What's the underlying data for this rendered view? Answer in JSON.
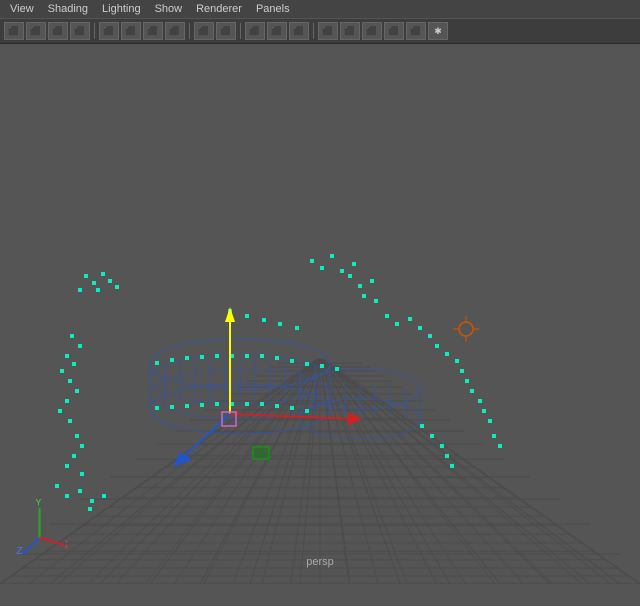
{
  "menubar": {
    "items": [
      "View",
      "Shading",
      "Lighting",
      "Show",
      "Renderer",
      "Panels"
    ]
  },
  "toolbar": {
    "buttons": [
      {
        "name": "select-tool",
        "icon": "▶"
      },
      {
        "name": "move-tool",
        "icon": "✛"
      },
      {
        "name": "rotate-tool",
        "icon": "↻"
      },
      {
        "name": "scale-tool",
        "icon": "⤢"
      },
      {
        "name": "universal-tool",
        "icon": "⊕"
      },
      {
        "name": "soft-select",
        "icon": "⬡"
      },
      {
        "name": "snap-grid",
        "icon": "⊞"
      },
      {
        "name": "snap-curve",
        "icon": "〜"
      },
      {
        "name": "snap-point",
        "icon": "•"
      },
      {
        "name": "snap-surface",
        "icon": "⬜"
      },
      {
        "name": "wireframe",
        "icon": "⬛"
      },
      {
        "name": "smooth-shade",
        "icon": "⬛"
      },
      {
        "name": "texture",
        "icon": "⬛"
      },
      {
        "name": "light",
        "icon": "⬛"
      },
      {
        "name": "camera",
        "icon": "⬛"
      },
      {
        "name": "render",
        "icon": "⬛"
      }
    ]
  },
  "viewport": {
    "label": "persp",
    "bg_color": "#555555"
  },
  "scene": {
    "objects": "wireframe mesh with vertices"
  }
}
